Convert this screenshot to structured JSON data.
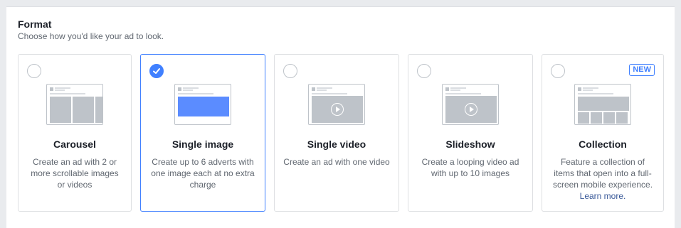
{
  "format": {
    "title": "Format",
    "subtitle": "Choose how you'd like your ad to look."
  },
  "cards": [
    {
      "id": "carousel",
      "title": "Carousel",
      "description": "Create an ad with 2 or more scrollable images or videos",
      "selected": false
    },
    {
      "id": "single-image",
      "title": "Single image",
      "description": "Create up to 6 adverts with one image each at no extra charge",
      "selected": true
    },
    {
      "id": "single-video",
      "title": "Single video",
      "description": "Create an ad with one video",
      "selected": false
    },
    {
      "id": "slideshow",
      "title": "Slideshow",
      "description": "Create a looping video ad with up to 10 images",
      "selected": false
    },
    {
      "id": "collection",
      "title": "Collection",
      "description": "Feature a collection of items that open into a full-screen mobile experience.",
      "link_text": "Learn more.",
      "badge": "NEW",
      "selected": false
    }
  ],
  "colors": {
    "accent": "#4080ff",
    "link": "#385898",
    "border": "#dddfe2",
    "placeholder": "#bec3c9"
  },
  "icons": {
    "selected_radio": "checkmark-icon",
    "video": "play-icon"
  }
}
